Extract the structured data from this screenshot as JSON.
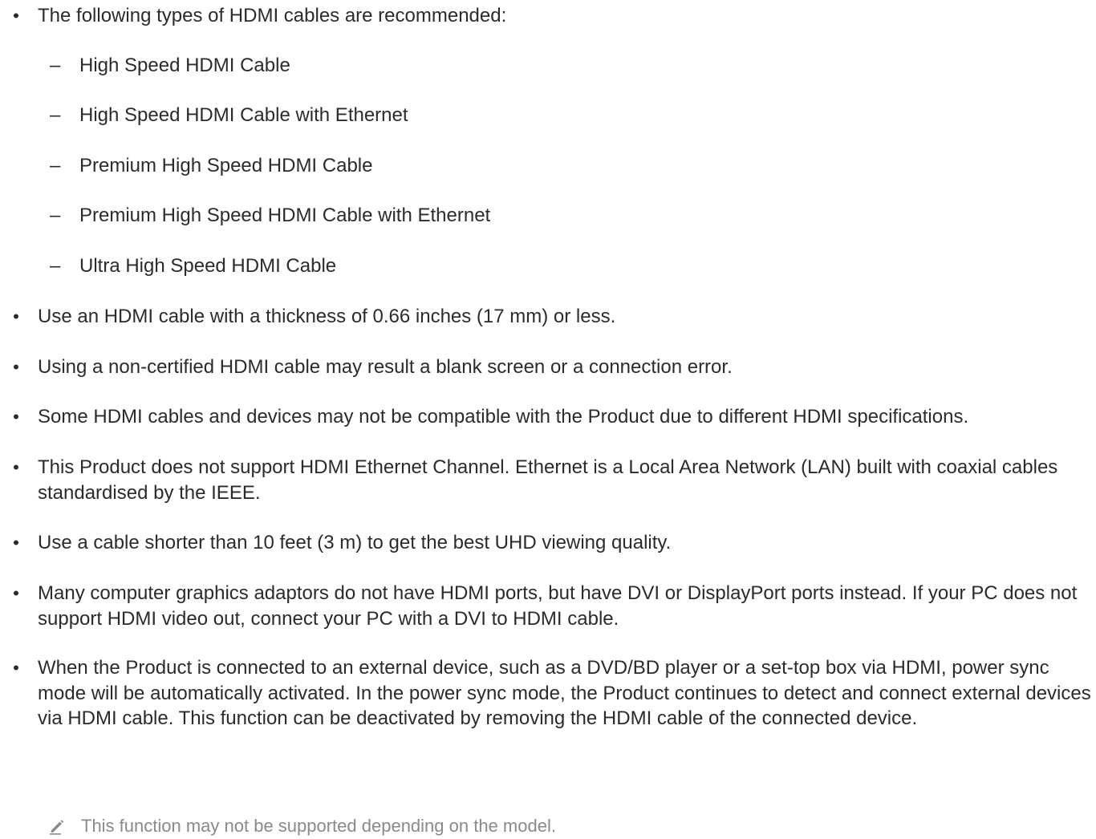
{
  "bullet_glyph": "•",
  "dash_glyph": "–",
  "intro": "The following types of HDMI cables are recommended:",
  "cable_types": [
    "High Speed HDMI Cable",
    "High Speed HDMI Cable with Ethernet",
    "Premium High Speed HDMI Cable",
    "Premium High Speed HDMI Cable with Ethernet",
    "Ultra High Speed HDMI Cable"
  ],
  "bullets": [
    "Use an HDMI cable with a thickness of 0.66 inches (17 mm) or less.",
    "Using a non-certified HDMI cable may result a blank screen or a connection error.",
    "Some HDMI cables and devices may not be compatible with the Product due to different HDMI specifications.",
    "This Product does not support HDMI Ethernet Channel. Ethernet is a Local Area Network (LAN) built with coaxial cables standardised by the IEEE.",
    "Use a cable shorter than 10 feet (3 m) to get the best UHD viewing quality.",
    "Many computer graphics adaptors do not have HDMI ports, but have DVI or DisplayPort ports instead. If your PC does not support HDMI video out, connect your PC with a DVI to HDMI cable.",
    "When the Product is connected to an external device, such as a DVD/BD player or a set-top box via HDMI, power sync mode will be automatically activated. In the power sync mode, the Product continues to detect and connect external devices via HDMI cable. This function can be deactivated by removing the HDMI cable of the connected device."
  ],
  "note": {
    "icon": "pencil-icon",
    "text": "This function may not be supported depending on the model."
  },
  "colors": {
    "text": "#2b2b2b",
    "note_text": "#8a8a8a"
  }
}
